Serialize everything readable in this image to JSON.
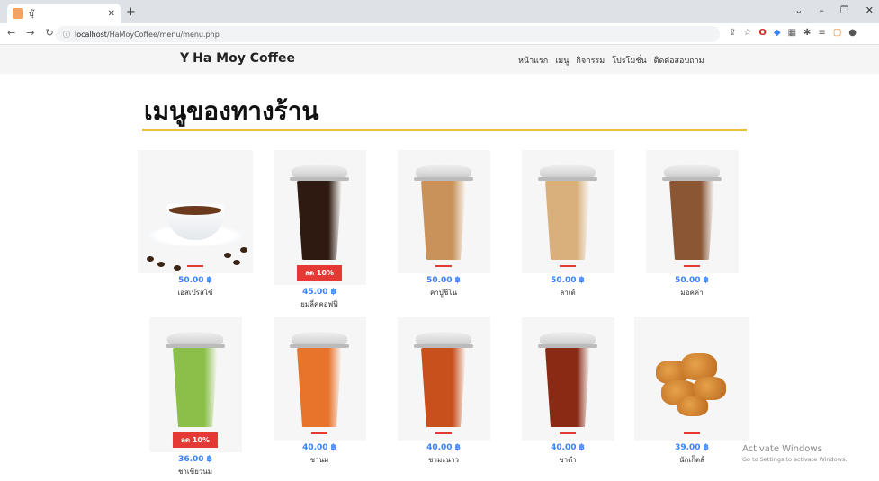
{
  "browser": {
    "tab_title": "บุ๊",
    "url_host": "localhost",
    "url_path": "/HaMoyCoffee/menu/menu.php"
  },
  "site": {
    "brand": "Ha Moy Coffee",
    "nav": [
      "หน้าแรก",
      "เมนู",
      "กิจกรรม",
      "โปรโมชั่น",
      "ติดต่อสอบถาม"
    ]
  },
  "page": {
    "title": "เมนูของทางร้าน"
  },
  "menu": [
    {
      "price": "50.00 ฿",
      "name": "เอสเปรสโซ่",
      "discount": "",
      "drink_color": "#6b3a1c",
      "kind": "cup"
    },
    {
      "price": "45.00 ฿",
      "name": "ยมลี่คคอฟฟี่",
      "discount": "ลด 10%",
      "drink_color": "#2e1a10",
      "kind": "plastic"
    },
    {
      "price": "50.00 ฿",
      "name": "คาปูชิโน",
      "discount": "",
      "drink_color": "#c9925a",
      "kind": "plastic"
    },
    {
      "price": "50.00 ฿",
      "name": "ลาเต้",
      "discount": "",
      "drink_color": "#d9b07c",
      "kind": "plastic"
    },
    {
      "price": "50.00 ฿",
      "name": "มอคค่า",
      "discount": "",
      "drink_color": "#8a5634",
      "kind": "plastic"
    },
    {
      "price": "36.00 ฿",
      "name": "ชาเขียวนม",
      "discount": "ลด 10%",
      "drink_color": "#8bbf4a",
      "kind": "plastic"
    },
    {
      "price": "40.00 ฿",
      "name": "ชานม",
      "discount": "",
      "drink_color": "#e8732a",
      "kind": "plastic"
    },
    {
      "price": "40.00 ฿",
      "name": "ชามะนาว",
      "discount": "",
      "drink_color": "#c8501c",
      "kind": "plastic"
    },
    {
      "price": "40.00 ฿",
      "name": "ชาดำ",
      "discount": "",
      "drink_color": "#8a2a14",
      "kind": "plastic"
    },
    {
      "price": "39.00 ฿",
      "name": "นักเก็ตส์",
      "discount": "",
      "drink_color": "#c47a2a",
      "kind": "nugget"
    }
  ],
  "watermark": {
    "line1": "Activate Windows",
    "line2": "Go to Settings to activate Windows."
  }
}
